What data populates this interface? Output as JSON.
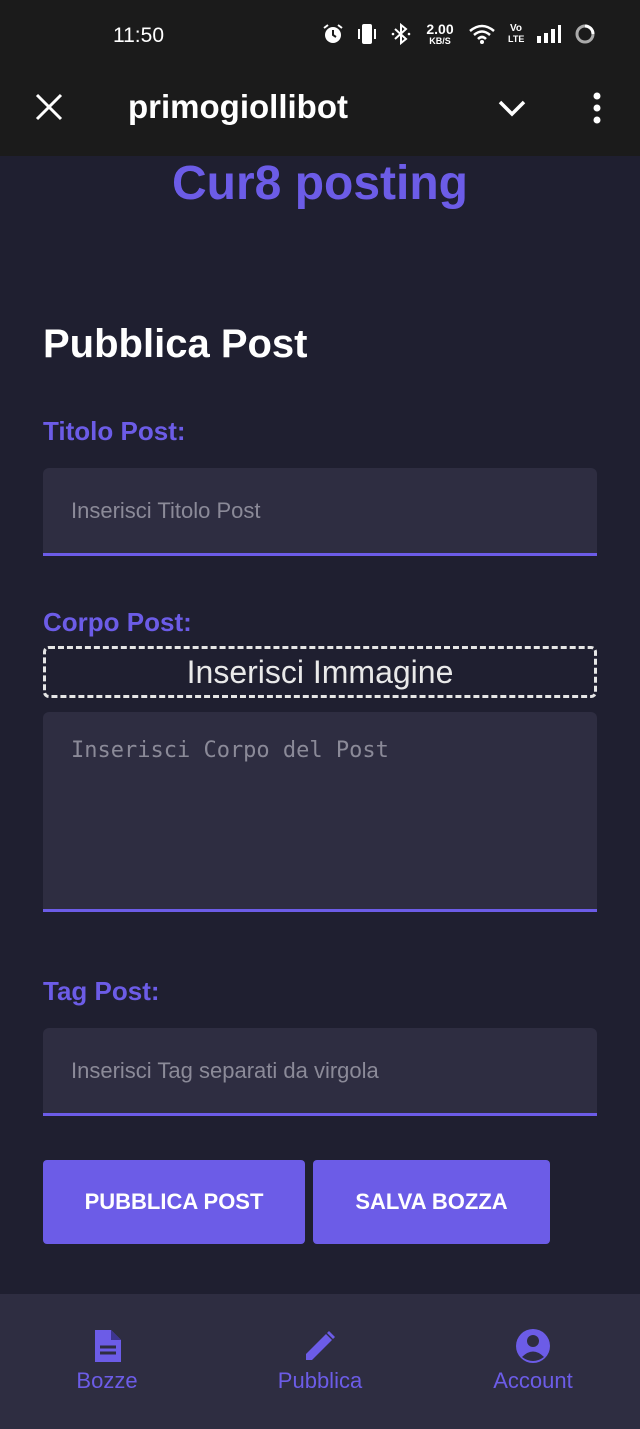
{
  "status_bar": {
    "time": "11:50",
    "speed_value": "2.00",
    "speed_unit": "KB/S",
    "volte_line1": "Vo",
    "volte_line2": "LTE",
    "icons": [
      "alarm-icon",
      "vibrate-icon",
      "bluetooth-icon",
      "wifi-icon",
      "signal-icon",
      "loading-icon"
    ]
  },
  "top_bar": {
    "title": "primogiollibot",
    "icons": [
      "close-icon",
      "chevron-down-icon",
      "more-vert-icon"
    ]
  },
  "app": {
    "title": "Cur8 posting"
  },
  "form": {
    "section_title": "Pubblica Post",
    "title_label": "Titolo Post:",
    "title_placeholder": "Inserisci Titolo Post",
    "body_label": "Corpo Post:",
    "insert_image_label": "Inserisci Immagine",
    "body_placeholder": "Inserisci Corpo del Post",
    "tag_label": "Tag Post:",
    "tag_placeholder": "Inserisci Tag separati da virgola",
    "publish_button": "PUBBLICA POST",
    "save_draft_button": "SALVA BOZZA"
  },
  "bottom_nav": {
    "items": [
      {
        "label": "Bozze",
        "icon": "document-icon"
      },
      {
        "label": "Pubblica",
        "icon": "pencil-icon"
      },
      {
        "label": "Account",
        "icon": "account-circle-icon"
      }
    ]
  },
  "colors": {
    "accent": "#6c5ce7",
    "background": "#1f1f30",
    "input_background": "#2e2d41",
    "bar_background": "#1b1b1b"
  }
}
